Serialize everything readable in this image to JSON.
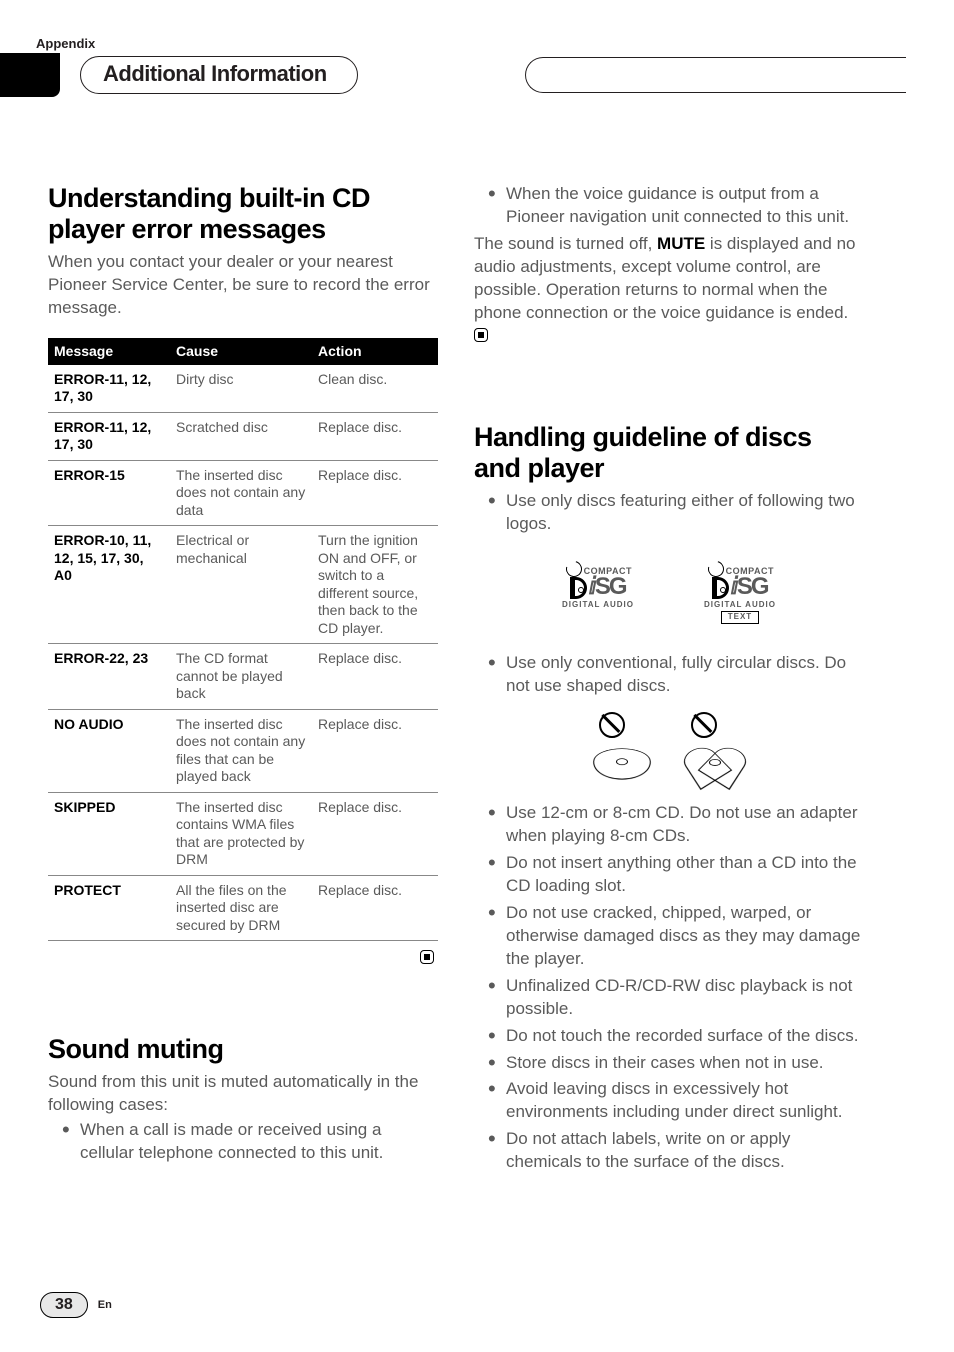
{
  "appendix": "Appendix",
  "section_title": "Additional Information",
  "page_number": "38",
  "lang": "En",
  "left": {
    "h1": "Understanding built-in CD player error messages",
    "intro": "When you contact your dealer or your nearest Pioneer Service Center, be sure to record the error message.",
    "table": {
      "headers": [
        "Message",
        "Cause",
        "Action"
      ],
      "rows": [
        {
          "message": "ERROR-11, 12, 17, 30",
          "cause": "Dirty disc",
          "action": "Clean disc."
        },
        {
          "message": "ERROR-11, 12, 17, 30",
          "cause": "Scratched disc",
          "action": "Replace disc."
        },
        {
          "message": "ERROR-15",
          "cause": "The inserted disc does not contain any data",
          "action": "Replace disc."
        },
        {
          "message": "ERROR-10, 11, 12, 15, 17, 30, A0",
          "cause": "Electrical or mechanical",
          "action": "Turn the ignition ON and OFF, or switch to a different source, then back to the CD player."
        },
        {
          "message": "ERROR-22, 23",
          "cause": "The CD format cannot be played back",
          "action": "Replace disc."
        },
        {
          "message": "NO AUDIO",
          "cause": "The inserted disc does not contain any files that can be played back",
          "action": "Replace disc."
        },
        {
          "message": "SKIPPED",
          "cause": "The inserted disc contains WMA files that are protected by DRM",
          "action": "Replace disc."
        },
        {
          "message": "PROTECT",
          "cause": "All the files on the inserted disc are secured by DRM",
          "action": "Replace disc."
        }
      ]
    },
    "h2": "Sound muting",
    "mute_intro": "Sound from this unit is muted automatically in the following cases:",
    "mute_b1": "When a call is made or received using a cellular telephone connected to this unit."
  },
  "right": {
    "mute_b2": "When the voice guidance is output from a Pioneer navigation unit connected to this unit.",
    "mute_para_a": "The sound is turned off, ",
    "mute_bold": "MUTE",
    "mute_para_b": " is displayed and no audio adjustments, except volume control, are possible. Operation returns to normal when the phone connection or the voice guidance is ended.",
    "h1": "Handling guideline of discs and player",
    "b1": "Use only discs featuring either of following two logos.",
    "logo": {
      "compact": "COMPACT",
      "digital_audio": "DIGITAL AUDIO",
      "text": "TEXT"
    },
    "b2": "Use only conventional, fully circular discs. Do not use shaped discs.",
    "b3": "Use 12-cm or 8-cm CD. Do not use an adapter when playing 8-cm CDs.",
    "b4": "Do not insert anything other than a CD into the CD loading slot.",
    "b5": "Do not use cracked, chipped, warped, or otherwise damaged discs as they may damage the player.",
    "b6": "Unfinalized CD-R/CD-RW disc playback is not possible.",
    "b7": "Do not touch the recorded surface of the discs.",
    "b8": "Store discs in their cases when not in use.",
    "b9": "Avoid leaving discs in excessively hot environments including under direct sunlight.",
    "b10": "Do not attach labels, write on or apply chemicals to the surface of the discs."
  }
}
